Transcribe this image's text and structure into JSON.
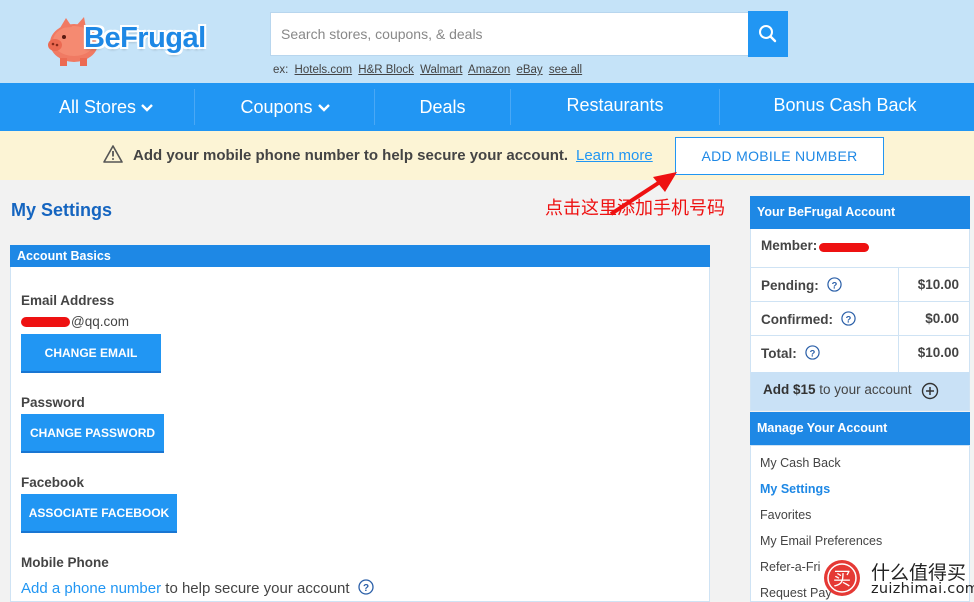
{
  "brand": {
    "name": "BeFrugal",
    "primary_color": "#2196f3",
    "dark_color": "#1565c0",
    "header_bg": "#c5e3f8"
  },
  "search": {
    "placeholder": "Search stores, coupons, & deals",
    "hint_prefix": "ex:",
    "hints": [
      "Hotels.com",
      "H&R Block",
      "Walmart",
      "Amazon",
      "eBay",
      "see all"
    ]
  },
  "nav": {
    "items": [
      {
        "label": "All Stores",
        "has_dropdown": true
      },
      {
        "label": "Coupons",
        "has_dropdown": true
      },
      {
        "label": "Deals",
        "has_dropdown": false
      },
      {
        "label": "Restaurants",
        "has_dropdown": false
      },
      {
        "label": "Bonus Cash Back",
        "has_dropdown": false
      }
    ]
  },
  "alert": {
    "icon": "warning-icon",
    "message": "Add your mobile phone number to help secure your account.",
    "link": "Learn more",
    "button": "ADD MOBILE NUMBER",
    "bg_color": "#fcf4d5"
  },
  "annotation": {
    "text": "点击这里添加手机号码",
    "color": "#ee1111"
  },
  "main": {
    "title": "My Settings",
    "panel_title": "Account Basics",
    "email": {
      "label": "Email Address",
      "value_suffix": "@qq.com",
      "button": "CHANGE EMAIL"
    },
    "password": {
      "label": "Password",
      "button": "CHANGE PASSWORD"
    },
    "facebook": {
      "label": "Facebook",
      "button": "ASSOCIATE FACEBOOK"
    },
    "mobile": {
      "label": "Mobile Phone",
      "link": "Add a phone number",
      "text": "to help secure your account"
    }
  },
  "sidebar": {
    "account_title": "Your BeFrugal Account",
    "member_label": "Member:",
    "rows": [
      {
        "label": "Pending:",
        "value": "$10.00"
      },
      {
        "label": "Confirmed:",
        "value": "$0.00"
      },
      {
        "label": "Total:",
        "value": "$10.00"
      }
    ],
    "add_bold": "Add $15",
    "add_text": "to your account",
    "manage_title": "Manage Your Account",
    "manage_items": [
      {
        "label": "My Cash Back",
        "active": false
      },
      {
        "label": "My Settings",
        "active": true
      },
      {
        "label": "Favorites",
        "active": false
      },
      {
        "label": "My Email Preferences",
        "active": false
      },
      {
        "label": "Refer-a-Fri",
        "active": false
      },
      {
        "label": "Request Pay",
        "active": false
      }
    ]
  },
  "watermark": {
    "line1": "什么值得买",
    "line2": "zuizhimai.com",
    "badge_char": "买"
  }
}
